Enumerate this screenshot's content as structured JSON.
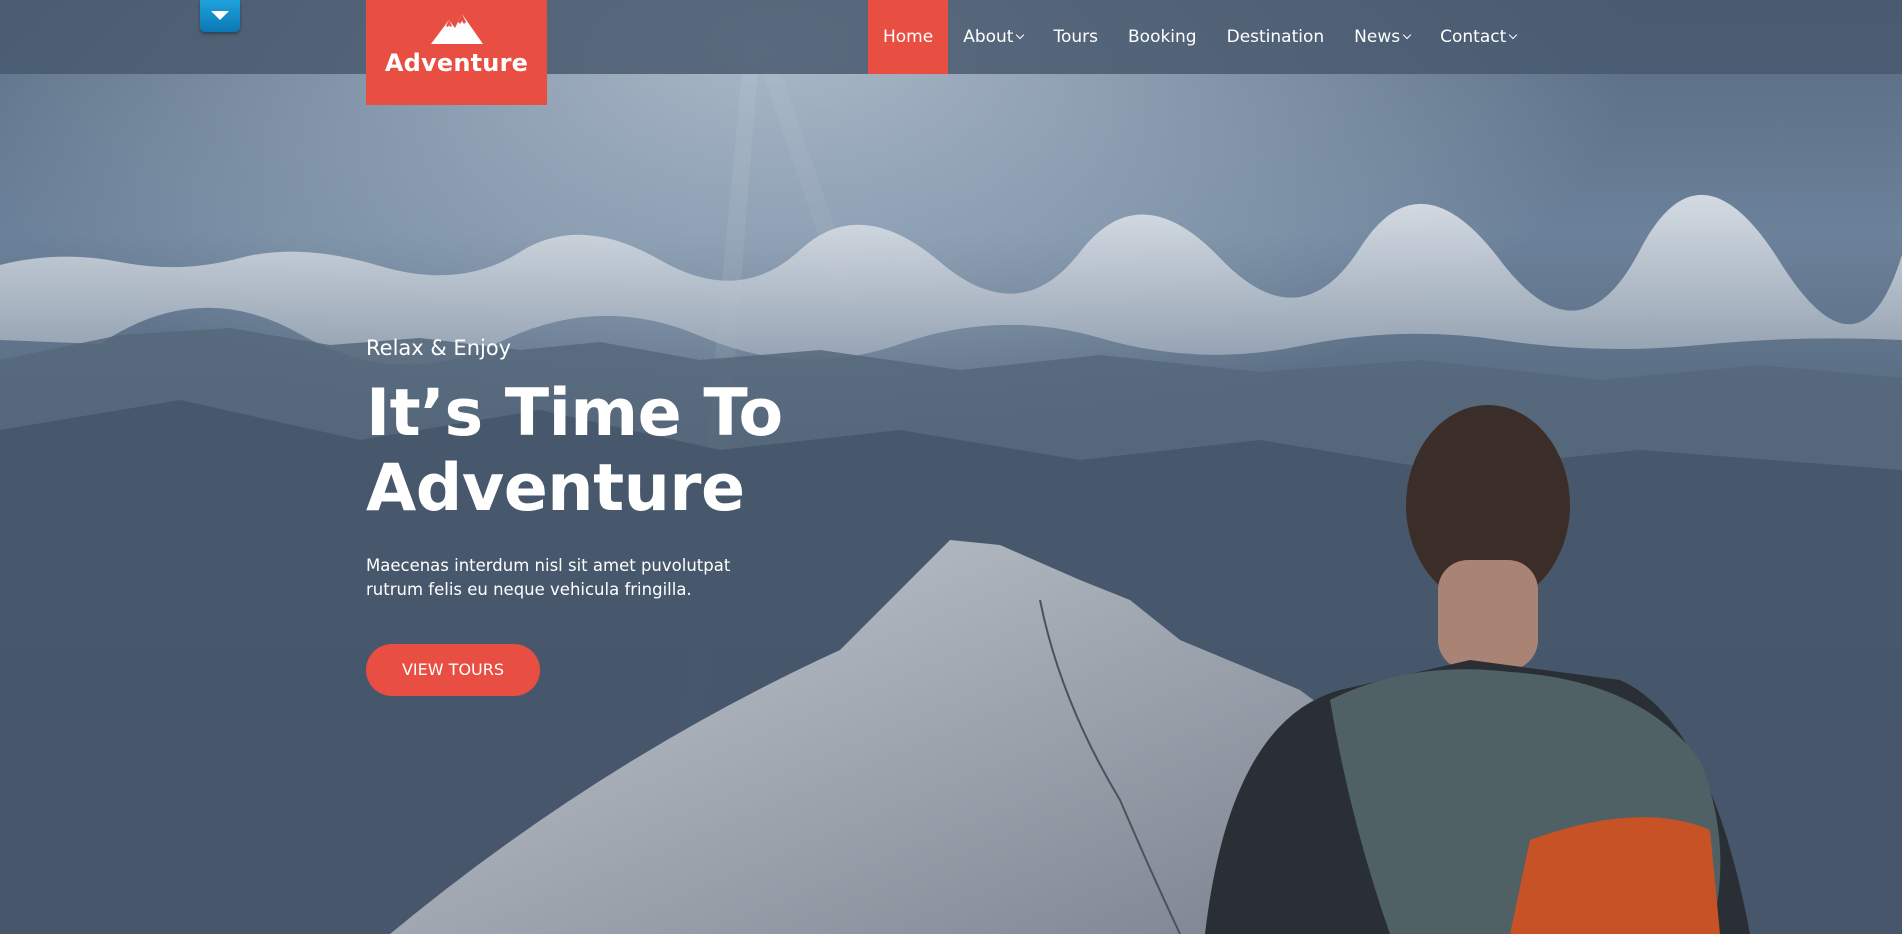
{
  "header": {
    "toggle_icon": "caret-down-icon",
    "logo": {
      "icon": "mountain-icon",
      "text": "Adventure",
      "bg_color": "#e94e43"
    },
    "menu": [
      {
        "label": "Home",
        "active": true,
        "dropdown": false
      },
      {
        "label": "About",
        "active": false,
        "dropdown": true
      },
      {
        "label": "Tours",
        "active": false,
        "dropdown": false
      },
      {
        "label": "Booking",
        "active": false,
        "dropdown": false
      },
      {
        "label": "Destination",
        "active": false,
        "dropdown": false
      },
      {
        "label": "News",
        "active": false,
        "dropdown": true
      },
      {
        "label": "Contact",
        "active": false,
        "dropdown": true
      }
    ]
  },
  "hero": {
    "eyebrow": "Relax & Enjoy",
    "title_line1": "It’s Time To",
    "title_line2": "Adventure",
    "desc_line1": "Maecenas interdum nisl sit amet puvolutpat",
    "desc_line2": "rutrum felis eu neque vehicula fringilla.",
    "cta_label": "VIEW TOURS"
  },
  "colors": {
    "accent": "#e94e43",
    "toggle_blue": "#1a8fd0"
  }
}
